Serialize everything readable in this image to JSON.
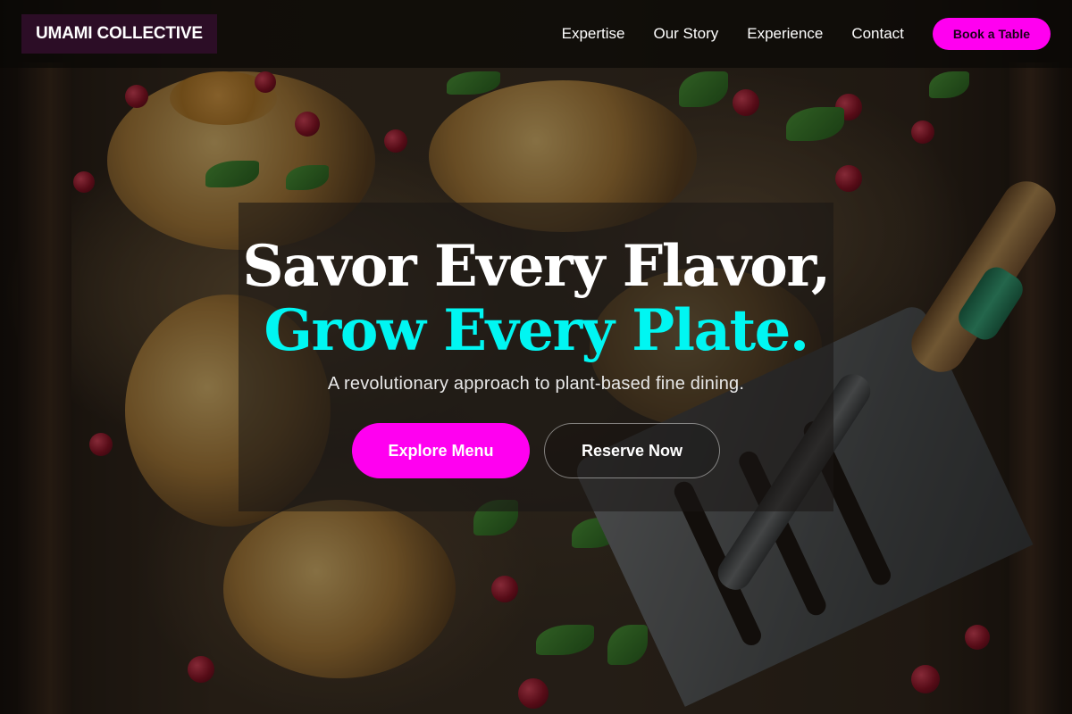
{
  "nav": {
    "brand": "UMAMI COLLECTIVE",
    "links": [
      "Expertise",
      "Our Story",
      "Experience",
      "Contact"
    ],
    "cta_label": "Book a Table"
  },
  "hero": {
    "headline_line1": "Savor Every Flavor,",
    "headline_line2": "Grow Every Plate.",
    "subheadline": "A revolutionary approach to plant-based fine dining.",
    "primary_button": "Explore Menu",
    "secondary_button": "Reserve Now"
  },
  "colors": {
    "accent_magenta": "#ff00f0",
    "accent_cyan": "#00f6f2",
    "brand_background": "#2c0d26"
  },
  "background_image": "roasted-cauliflower-pomegranate-on-tray-with-spatula"
}
